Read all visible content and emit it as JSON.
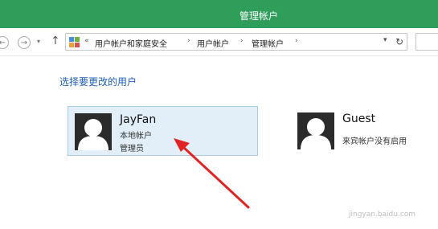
{
  "window": {
    "title": "管理帐户"
  },
  "nav": {
    "back": "←",
    "forward": "→",
    "up": "↑",
    "expand": "«",
    "breadcrumbs": [
      "用户帐户和家庭安全",
      "用户帐户",
      "管理帐户"
    ],
    "separator": "›",
    "dropdown": "▾",
    "refresh": "↻"
  },
  "main": {
    "heading": "选择要更改的用户",
    "accounts": [
      {
        "name": "JayFan",
        "type": "本地帐户",
        "role": "管理员",
        "selected": true
      },
      {
        "name": "Guest",
        "status": "来宾帐户没有启用",
        "selected": false
      }
    ]
  },
  "watermark": "jingyan.baidu.com",
  "colors": {
    "titlebar": "#2f9e5b",
    "heading": "#1e5fb4",
    "selection": "#e3eff8",
    "arrow": "#e02424"
  }
}
